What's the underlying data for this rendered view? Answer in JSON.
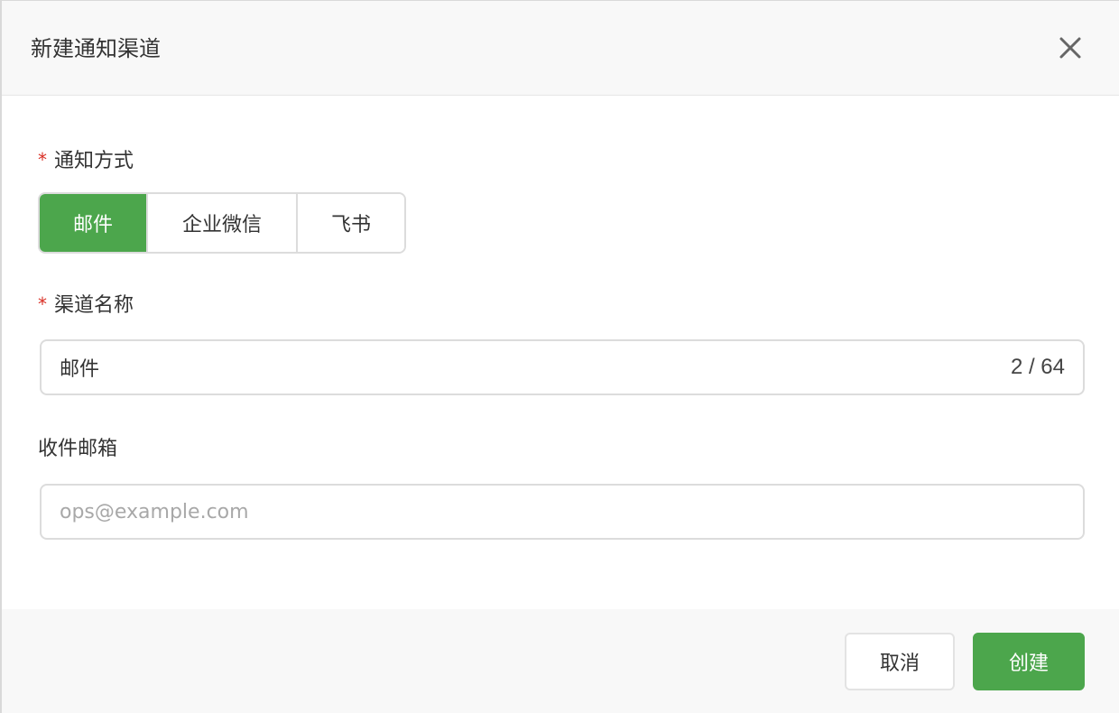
{
  "dialog": {
    "title": "新建通知渠道"
  },
  "form": {
    "method": {
      "required_mark": "*",
      "label": "通知方式",
      "options": [
        "邮件",
        "企业微信",
        "飞书"
      ],
      "selected": "邮件"
    },
    "channel_name": {
      "required_mark": "*",
      "label": "渠道名称",
      "value": "邮件",
      "counter": "2 / 64"
    },
    "recipient_email": {
      "label": "收件邮箱",
      "value": "",
      "placeholder": "ops@example.com"
    }
  },
  "footer": {
    "cancel_label": "取消",
    "create_label": "创建"
  },
  "colors": {
    "accent": "#4ca64c",
    "required": "#d93026"
  },
  "icons": {
    "close": "close-icon"
  }
}
